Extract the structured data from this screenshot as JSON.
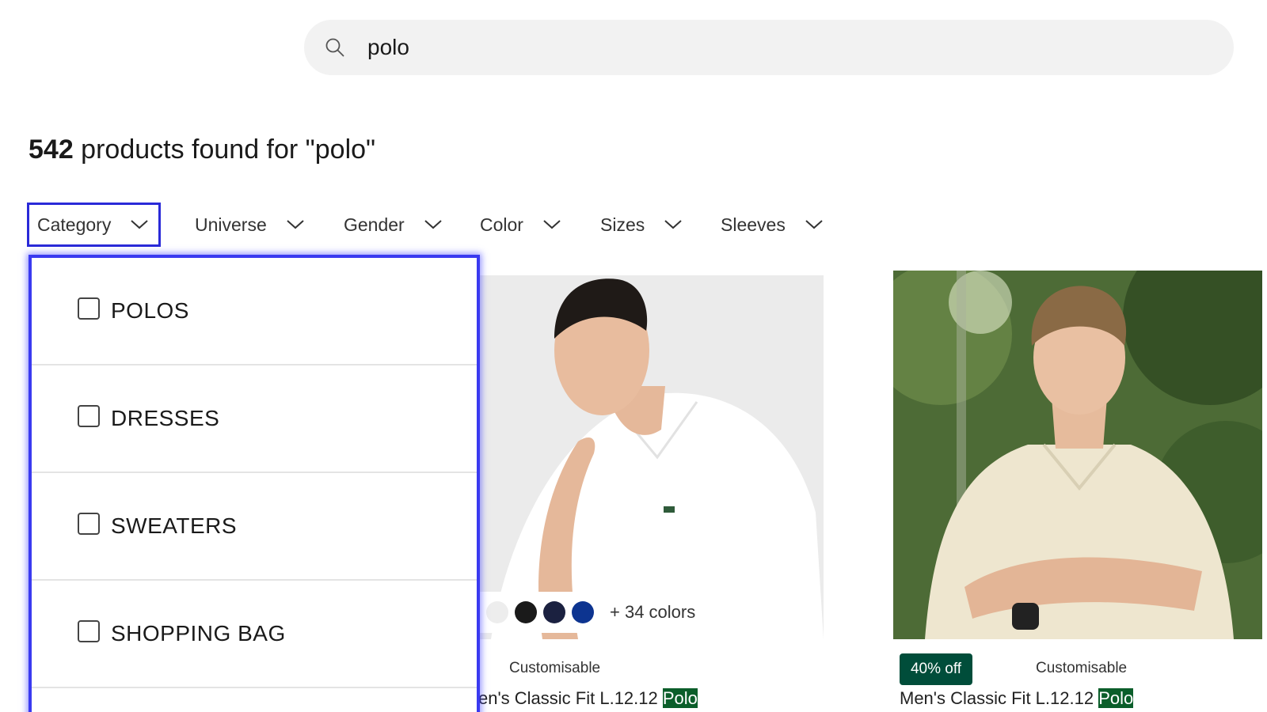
{
  "search": {
    "value": "polo"
  },
  "results": {
    "count": "542",
    "text": " products found for \"polo\""
  },
  "filters": [
    {
      "label": "Category"
    },
    {
      "label": "Universe"
    },
    {
      "label": "Gender"
    },
    {
      "label": "Color"
    },
    {
      "label": "Sizes"
    },
    {
      "label": "Sleeves"
    }
  ],
  "category_dropdown": {
    "options": [
      {
        "label": "POLOS"
      },
      {
        "label": "DRESSES"
      },
      {
        "label": "SWEATERS"
      },
      {
        "label": "SHOPPING BAG"
      }
    ]
  },
  "products": [
    {
      "more_colors": "+ 34 colors",
      "swatch_colors": [
        "#ededed",
        "#1a1a1a",
        "#1b2140",
        "#0d3490"
      ],
      "tag": "Customisable",
      "name_prefix": "en's Classic Fit L.12.12 ",
      "name_highlight": "Polo"
    },
    {
      "discount": "40% off",
      "tag": "Customisable",
      "name_prefix": "Men's Classic Fit L.12.12 ",
      "name_highlight": "Polo"
    }
  ],
  "colors": {
    "active_border": "#2a2ad8",
    "highlight": "#0b5e2a",
    "discount_bg": "#004d3a",
    "search_bg": "#f2f2f2"
  }
}
